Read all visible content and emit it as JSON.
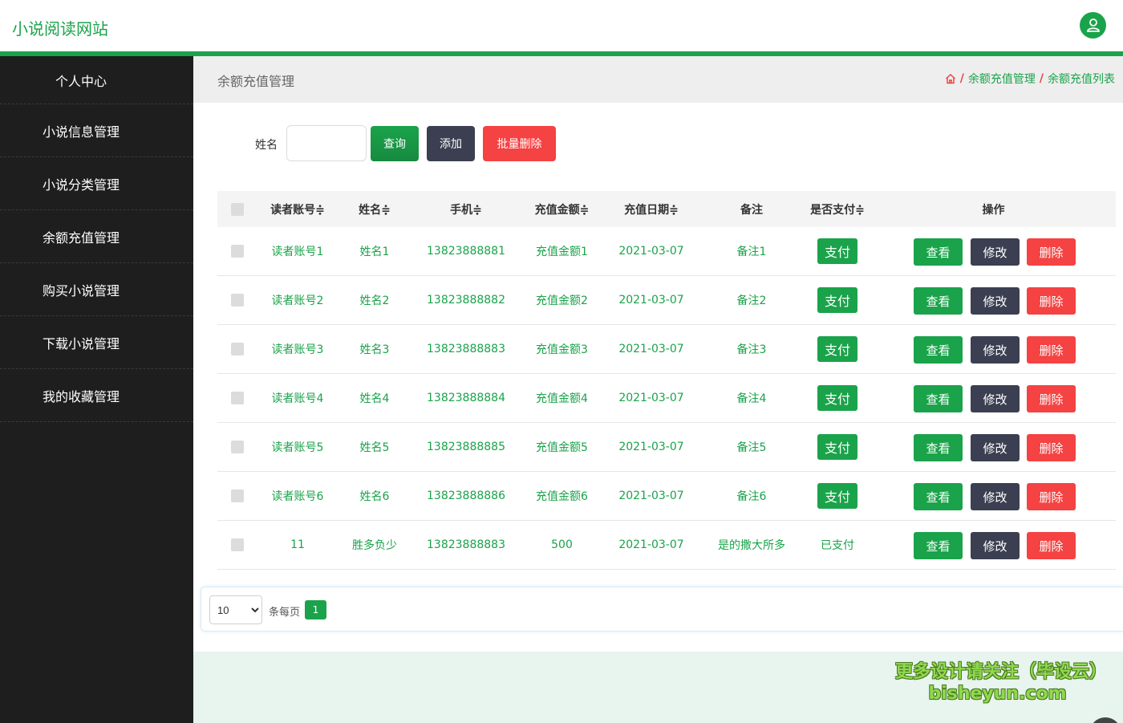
{
  "topbar": {
    "site_title": "小说阅读网站",
    "avatar_icon": "user-icon"
  },
  "sidebar": {
    "items": [
      {
        "label": "个人中心"
      },
      {
        "label": "小说信息管理"
      },
      {
        "label": "小说分类管理"
      },
      {
        "label": "余额充值管理"
      },
      {
        "label": "购买小说管理"
      },
      {
        "label": "下载小说管理"
      },
      {
        "label": "我的收藏管理"
      }
    ]
  },
  "header": {
    "page_title": "余额充值管理",
    "breadcrumb": {
      "sep": "/",
      "item1": "余额充值管理",
      "item2": "余额充值列表"
    }
  },
  "search": {
    "label": "姓名",
    "value": "",
    "query_label": "查询",
    "add_label": "添加",
    "batch_delete_label": "批量删除"
  },
  "table": {
    "headers": {
      "account": "读者账号≑",
      "name": "姓名≑",
      "phone": "手机≑",
      "amount": "充值金额≑",
      "date": "充值日期≑",
      "note": "备注",
      "paid": "是否支付≑",
      "op": "操作"
    },
    "pay_label": "支付",
    "view_label": "查看",
    "edit_label": "修改",
    "delete_label": "删除",
    "rows": [
      {
        "account": "读者账号1",
        "name": "姓名1",
        "phone": "13823888881",
        "amount": "充值金额1",
        "date": "2021-03-07",
        "note": "备注1",
        "paid": ""
      },
      {
        "account": "读者账号2",
        "name": "姓名2",
        "phone": "13823888882",
        "amount": "充值金额2",
        "date": "2021-03-07",
        "note": "备注2",
        "paid": ""
      },
      {
        "account": "读者账号3",
        "name": "姓名3",
        "phone": "13823888883",
        "amount": "充值金额3",
        "date": "2021-03-07",
        "note": "备注3",
        "paid": ""
      },
      {
        "account": "读者账号4",
        "name": "姓名4",
        "phone": "13823888884",
        "amount": "充值金额4",
        "date": "2021-03-07",
        "note": "备注4",
        "paid": ""
      },
      {
        "account": "读者账号5",
        "name": "姓名5",
        "phone": "13823888885",
        "amount": "充值金额5",
        "date": "2021-03-07",
        "note": "备注5",
        "paid": ""
      },
      {
        "account": "读者账号6",
        "name": "姓名6",
        "phone": "13823888886",
        "amount": "充值金额6",
        "date": "2021-03-07",
        "note": "备注6",
        "paid": ""
      },
      {
        "account": "11",
        "name": "胜多负少",
        "phone": "13823888883",
        "amount": "500",
        "date": "2021-03-07",
        "note": "是的撒大所多",
        "paid": "已支付"
      }
    ]
  },
  "pager": {
    "page_size": "10",
    "per_page_label": "条每页",
    "current_page": "1"
  },
  "watermark": {
    "line1": "更多设计请关注（毕设云）",
    "line2": "bisheyun.com"
  },
  "colors": {
    "brand_green": "#1aa34a",
    "sidebar_bg": "#1e1e1e",
    "danger": "#f54242",
    "dark_btn": "#3b3f51"
  }
}
